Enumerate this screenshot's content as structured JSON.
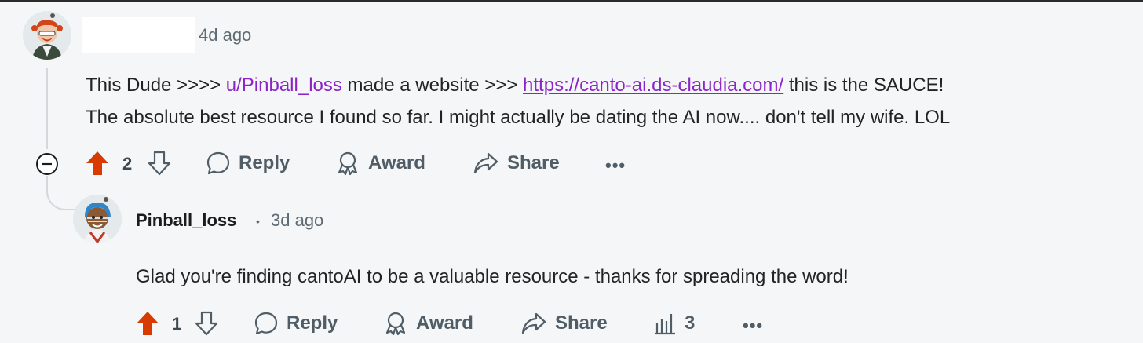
{
  "comment": {
    "time": "4d ago",
    "body": {
      "prefix": "This Dude >>>> ",
      "mention": "u/Pinball_loss",
      "middle": " made a website >>> ",
      "link": "https://canto-ai.ds-claudia.com/",
      "suffix": " this is the SAUCE!",
      "line2": "The absolute best resource I found so far. I might actually be dating the AI now.... don't tell my wife. LOL"
    },
    "vote_count": "2",
    "reply_label": "Reply",
    "award_label": "Award",
    "share_label": "Share",
    "more_label": "•••"
  },
  "reply": {
    "username": "Pinball_loss",
    "separator": "•",
    "time": "3d ago",
    "body": "Glad you're finding cantoAI to be a valuable resource - thanks for spreading the word!",
    "vote_count": "1",
    "reply_label": "Reply",
    "award_label": "Award",
    "share_label": "Share",
    "insights_count": "3",
    "more_label": "•••"
  },
  "colors": {
    "upvote": "#d93a00",
    "link": "#8b25c8",
    "muted": "#5f6b73",
    "background": "#f5f6f7"
  },
  "icons": [
    "avatar",
    "collapse-icon",
    "upvote-icon",
    "downvote-icon",
    "reply-icon",
    "award-icon",
    "share-icon",
    "insights-icon",
    "more-icon"
  ]
}
